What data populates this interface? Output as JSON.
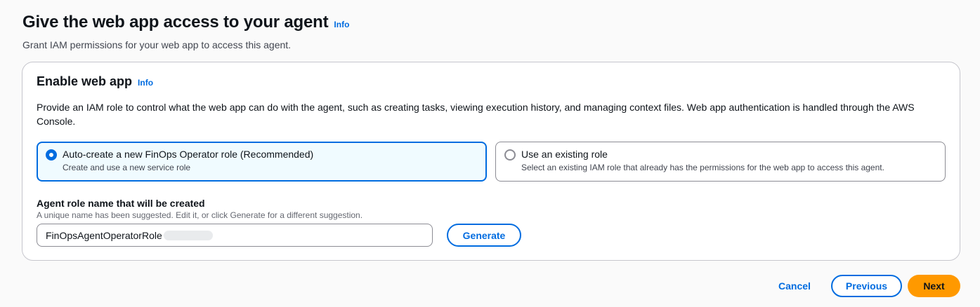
{
  "header": {
    "title": "Give the web app access to your agent",
    "info_label": "Info",
    "description": "Grant IAM permissions for your web app to access this agent."
  },
  "card": {
    "title": "Enable web app",
    "info_label": "Info",
    "description": "Provide an IAM role to control what the web app can do with the agent, such as creating tasks, viewing execution history, and managing context files. Web app authentication is handled through the AWS Console."
  },
  "role_options": [
    {
      "label": "Auto-create a new FinOps Operator role (Recommended)",
      "description": "Create and use a new service role",
      "selected": true
    },
    {
      "label": "Use an existing role",
      "description": "Select an existing IAM role that already has the permissions for the web app to access this agent.",
      "selected": false
    }
  ],
  "role_name_field": {
    "label": "Agent role name that will be created",
    "description": "A unique name has been suggested. Edit it, or click Generate for a different suggestion.",
    "value": "FinOpsAgentOperatorRole",
    "generate_label": "Generate"
  },
  "footer": {
    "cancel_label": "Cancel",
    "previous_label": "Previous",
    "next_label": "Next"
  },
  "colors": {
    "accent": "#006ce0",
    "primary_button": "#ff9900",
    "selected_tile_bg": "#f0fbff"
  }
}
